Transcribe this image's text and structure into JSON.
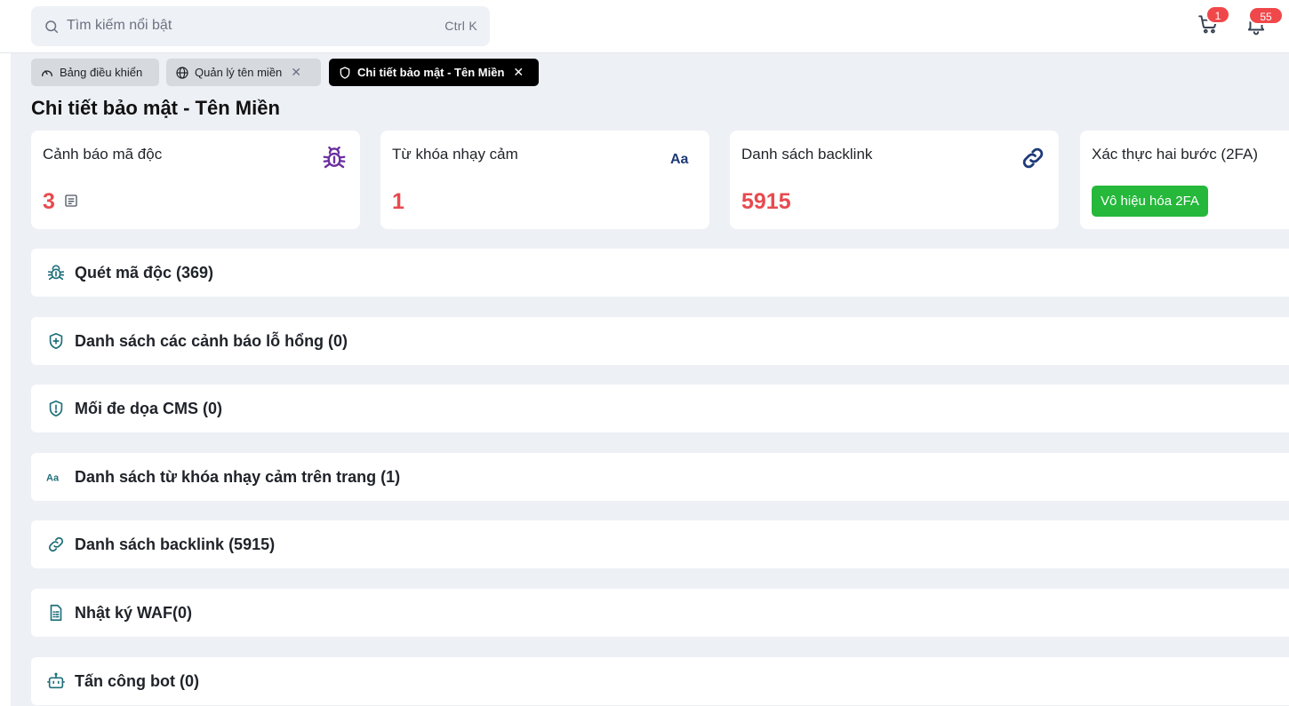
{
  "header": {
    "search_placeholder": "Tìm kiếm nổi bật",
    "search_shortcut": "Ctrl K",
    "cart_count": "1",
    "notification_count": "55"
  },
  "tabs": [
    {
      "label": "Bảng điều khiển",
      "icon": "gauge-icon",
      "closable": false,
      "active": false
    },
    {
      "label": "Quản lý tên miền",
      "icon": "globe-icon",
      "closable": true,
      "active": false
    },
    {
      "label": "Chi tiết bảo mật - Tên Miền",
      "icon": "shield-icon",
      "closable": true,
      "active": true
    }
  ],
  "page_title": "Chi tiết bảo mật - Tên Miền",
  "cards": [
    {
      "label": "Cảnh báo mã độc",
      "value": "3",
      "icon": "bug-icon"
    },
    {
      "label": "Từ khóa nhạy cảm",
      "value": "1",
      "icon": "font-icon"
    },
    {
      "label": "Danh sách backlink",
      "value": "5915",
      "icon": "link-icon"
    },
    {
      "label": "Xác thực hai bước (2FA)",
      "button": "Vô hiệu hóa 2FA"
    }
  ],
  "sections": [
    {
      "title": "Quét mã độc (369)",
      "icon": "bug-icon"
    },
    {
      "title": "Danh sách các cảnh báo lỗ hổng (0)",
      "icon": "shield-plus-icon"
    },
    {
      "title": "Mối đe dọa CMS (0)",
      "icon": "shield-alert-icon"
    },
    {
      "title": "Danh sách từ khóa nhạy cảm trên trang (1)",
      "icon": "font-icon"
    },
    {
      "title": "Danh sách backlink (5915)",
      "icon": "link-icon"
    },
    {
      "title": "Nhật ký WAF(0)",
      "icon": "log-file-icon"
    },
    {
      "title": "Tấn công bot (0)",
      "icon": "bot-icon"
    }
  ],
  "colors": {
    "accent_red": "#e84a4f",
    "success_green": "#25b83b",
    "icon_teal": "#1f6f7a",
    "icon_purple": "#6b2fa0",
    "icon_navy": "#1e3a78"
  }
}
